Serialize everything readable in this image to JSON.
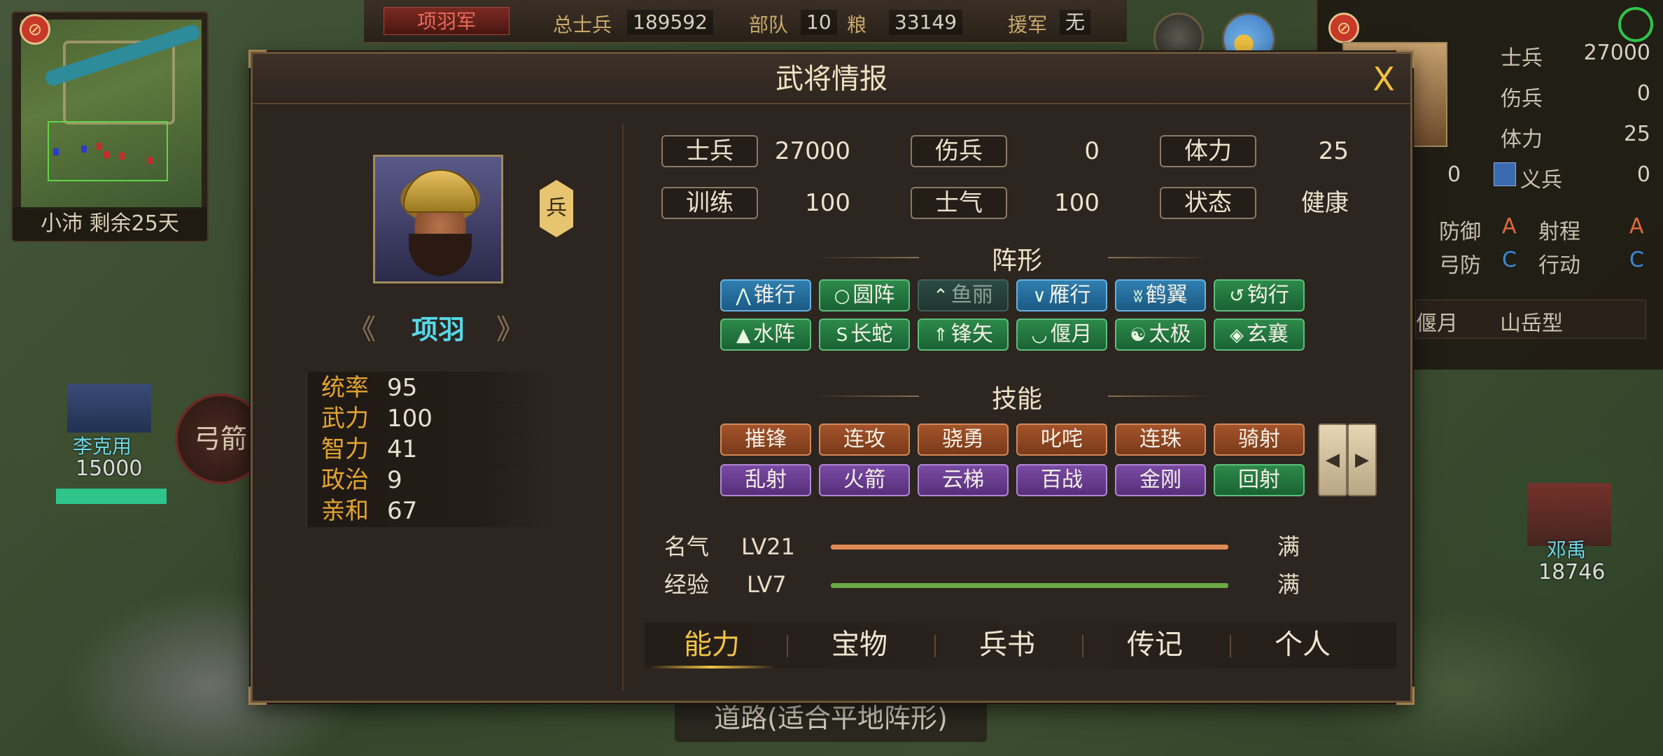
{
  "hud": {
    "minimap_caption": "小沛 剩余25天",
    "faction": "项羽军",
    "total_soldiers_label": "总士兵",
    "total_soldiers": "189592",
    "troops_label": "部队",
    "troops": "10",
    "food_label": "粮",
    "food": "33149",
    "reinforce_label": "援军",
    "reinforce": "无"
  },
  "right_panel": {
    "soldiers_label": "士兵",
    "soldiers": "27000",
    "wounded_label": "伤兵",
    "wounded": "0",
    "stamina_label": "体力",
    "stamina": "25",
    "militia_left": "0",
    "militia_label": "义兵",
    "militia": "0",
    "defense_label": "防御",
    "defense": "A",
    "range_label": "射程",
    "range": "A",
    "arrow_def_label": "弓防",
    "arrow_def": "C",
    "action_label": "行动",
    "action": "C",
    "formation_partial": "偃月",
    "terrain_type": "山岳型"
  },
  "map_units": {
    "left_name": "李克用",
    "left_count": "15000",
    "right_name": "邓禹",
    "right_count": "18746",
    "round_button": "弓箭",
    "road_tip": "道路(适合平地阵形)"
  },
  "dialog": {
    "title": "武将情报",
    "close": "X",
    "hero": {
      "name": "项羽",
      "type_tag": "兵",
      "stats": [
        {
          "label": "统率",
          "value": "95"
        },
        {
          "label": "武力",
          "value": "100"
        },
        {
          "label": "智力",
          "value": "41"
        },
        {
          "label": "政治",
          "value": "9"
        },
        {
          "label": "亲和",
          "value": "67"
        }
      ]
    },
    "status": [
      {
        "label": "士兵",
        "value": "27000"
      },
      {
        "label": "伤兵",
        "value": "0"
      },
      {
        "label": "体力",
        "value": "25"
      },
      {
        "label": "训练",
        "value": "100"
      },
      {
        "label": "士气",
        "value": "100"
      },
      {
        "label": "状态",
        "value": "健康"
      }
    ],
    "formation_title": "阵形",
    "formations": [
      {
        "label": "锥行",
        "icon": "⋀",
        "color": "blue"
      },
      {
        "label": "圆阵",
        "icon": "○",
        "color": "green"
      },
      {
        "label": "鱼丽",
        "icon": "⌃",
        "color": "dim"
      },
      {
        "label": "雁行",
        "icon": "∨",
        "color": "blue"
      },
      {
        "label": "鹤翼",
        "icon": "ʬ",
        "color": "blue"
      },
      {
        "label": "钩行",
        "icon": "↺",
        "color": "green"
      },
      {
        "label": "水阵",
        "icon": "▲",
        "color": "green"
      },
      {
        "label": "长蛇",
        "icon": "S",
        "color": "green"
      },
      {
        "label": "锋矢",
        "icon": "⇑",
        "color": "green"
      },
      {
        "label": "偃月",
        "icon": "◡",
        "color": "green"
      },
      {
        "label": "太极",
        "icon": "☯",
        "color": "green"
      },
      {
        "label": "玄襄",
        "icon": "◈",
        "color": "green"
      }
    ],
    "skills_title": "技能",
    "skills": [
      {
        "label": "摧锋",
        "color": "orange"
      },
      {
        "label": "连攻",
        "color": "orange"
      },
      {
        "label": "骁勇",
        "color": "orange"
      },
      {
        "label": "叱咤",
        "color": "orange"
      },
      {
        "label": "连珠",
        "color": "orange"
      },
      {
        "label": "骑射",
        "color": "orange"
      },
      {
        "label": "乱射",
        "color": "purple"
      },
      {
        "label": "火箭",
        "color": "purple"
      },
      {
        "label": "云梯",
        "color": "purple"
      },
      {
        "label": "百战",
        "color": "purple"
      },
      {
        "label": "金刚",
        "color": "purple"
      },
      {
        "label": "回射",
        "color": "green"
      }
    ],
    "fame": {
      "label": "名气",
      "level": "LV21",
      "full": "满",
      "progress": 1.0,
      "color": "#e08a56"
    },
    "exp": {
      "label": "经验",
      "level": "LV7",
      "full": "满",
      "progress": 1.0,
      "color": "#6aaa44"
    },
    "tabs": [
      "能力",
      "宝物",
      "兵书",
      "传记",
      "个人"
    ],
    "active_tab": 0
  }
}
